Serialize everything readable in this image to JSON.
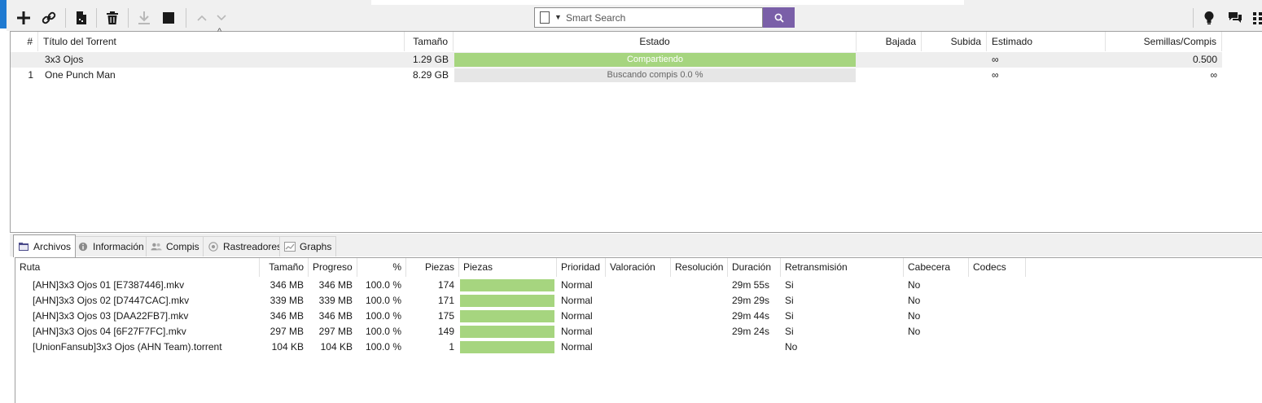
{
  "toolbar": {
    "search_placeholder": "Smart Search",
    "buttons": [
      {
        "name": "add-torrent",
        "glyph": "+"
      },
      {
        "name": "add-link",
        "glyph": "🔗"
      },
      {
        "name": "create-torrent",
        "glyph": "▤"
      },
      {
        "name": "remove",
        "glyph": "🗑"
      },
      {
        "name": "download",
        "glyph": "⤓"
      },
      {
        "name": "stop",
        "glyph": "■"
      },
      {
        "name": "move-up",
        "glyph": "∧"
      },
      {
        "name": "move-down",
        "glyph": "∨"
      }
    ],
    "search_accent": "#7a5fa8"
  },
  "torrents": {
    "columns": {
      "num": "#",
      "title": "Título del Torrent",
      "size": "Tamaño",
      "status": "Estado",
      "down": "Bajada",
      "up": "Subida",
      "eta": "Estimado",
      "ratio": "Semillas/Compis"
    },
    "rows": [
      {
        "num": "",
        "title": "3x3 Ojos",
        "size": "1.29 GB",
        "status": "Compartiendo",
        "down": "",
        "up": "",
        "eta": "∞",
        "ratio": "0.500"
      },
      {
        "num": "1",
        "title": "One Punch Man",
        "size": "8.29 GB",
        "status": "Buscando compis 0.0 %",
        "down": "",
        "up": "",
        "eta": "∞",
        "ratio": "∞"
      }
    ],
    "seeding_color": "#a6d57f"
  },
  "tabs": [
    {
      "label": "Archivos",
      "active": true
    },
    {
      "label": "Información",
      "active": false
    },
    {
      "label": "Compis",
      "active": false
    },
    {
      "label": "Rastreadores",
      "active": false
    },
    {
      "label": "Graphs",
      "active": false
    }
  ],
  "files": {
    "columns": {
      "path": "Ruta",
      "size": "Tamaño",
      "progress": "Progreso",
      "percent": "%",
      "pieces_count": "Piezas",
      "pieces_bar": "Piezas",
      "priority": "Prioridad",
      "rating": "Valoración",
      "resolution": "Resolución",
      "duration": "Duración",
      "streaming": "Retransmisión",
      "header": "Cabecera",
      "codecs": "Codecs"
    },
    "rows": [
      {
        "path": "[AHN]3x3 Ojos 01 [E7387446].mkv",
        "size": "346 MB",
        "progress": "346 MB",
        "percent": "100.0 %",
        "pieces": "174",
        "priority": "Normal",
        "duration": "29m 55s",
        "streaming": "Si",
        "header": "No"
      },
      {
        "path": "[AHN]3x3 Ojos 02 [D7447CAC].mkv",
        "size": "339 MB",
        "progress": "339 MB",
        "percent": "100.0 %",
        "pieces": "171",
        "priority": "Normal",
        "duration": "29m 29s",
        "streaming": "Si",
        "header": "No"
      },
      {
        "path": "[AHN]3x3 Ojos 03 [DAA22FB7].mkv",
        "size": "346 MB",
        "progress": "346 MB",
        "percent": "100.0 %",
        "pieces": "175",
        "priority": "Normal",
        "duration": "29m 44s",
        "streaming": "Si",
        "header": "No"
      },
      {
        "path": "[AHN]3x3 Ojos 04 [6F27F7FC].mkv",
        "size": "297 MB",
        "progress": "297 MB",
        "percent": "100.0 %",
        "pieces": "149",
        "priority": "Normal",
        "duration": "29m 24s",
        "streaming": "Si",
        "header": "No"
      },
      {
        "path": "[UnionFansub]3x3 Ojos (AHN Team).torrent",
        "size": "104 KB",
        "progress": "104 KB",
        "percent": "100.0 %",
        "pieces": "1",
        "priority": "Normal",
        "duration": "",
        "streaming": "No",
        "header": ""
      }
    ]
  }
}
